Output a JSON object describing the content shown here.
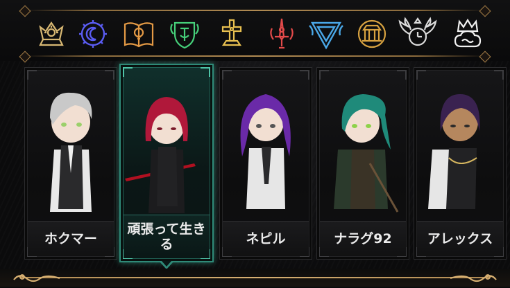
{
  "icon_bar": {
    "icons": [
      {
        "name": "sun-emblem-icon",
        "color": "#d8b873"
      },
      {
        "name": "gear-moon-icon",
        "color": "#5a5cf2"
      },
      {
        "name": "open-book-bulb-icon",
        "color": "#e59a45"
      },
      {
        "name": "shield-crest-icon",
        "color": "#46d07a"
      },
      {
        "name": "cross-pedestal-icon",
        "color": "#e8c050"
      },
      {
        "name": "sword-emblem-icon",
        "color": "#e34a4a"
      },
      {
        "name": "triangle-crest-icon",
        "color": "#4aa8e8"
      },
      {
        "name": "temple-emblem-icon",
        "color": "#d8a240"
      },
      {
        "name": "winged-clock-icon",
        "color": "#dcdcdc"
      },
      {
        "name": "crown-cloud-icon",
        "color": "#f2f2f2"
      }
    ]
  },
  "characters": [
    {
      "name": "ホクマー",
      "selected": false,
      "hair": "#c9c9c9",
      "coat": "#e8e8e8",
      "eyes": "#9bd06b",
      "suit": "#2a2a2c"
    },
    {
      "name": "頑張って生きる",
      "selected": true,
      "hair": "#b0183a",
      "coat": "#1c1c1e",
      "eyes": "#7a1a2a",
      "suit": "#222224"
    },
    {
      "name": "ネピル",
      "selected": false,
      "hair": "#6a2aa8",
      "coat": "#e6e6e6",
      "eyes": "#555555",
      "suit": "#2a2a2c"
    },
    {
      "name": "ナラグ92",
      "selected": false,
      "hair": "#1f8a7a",
      "coat": "#2b3a2c",
      "eyes": "#8ed24a",
      "suit": "#3a3326"
    },
    {
      "name": "アレックス",
      "selected": false,
      "hair": "#3a2250",
      "coat": "#e6e6e6",
      "eyes": "#2a2a2a",
      "suit": "#222224"
    }
  ],
  "colors": {
    "gold_trim": "#b08a52",
    "selected_accent": "#2f8a78"
  }
}
